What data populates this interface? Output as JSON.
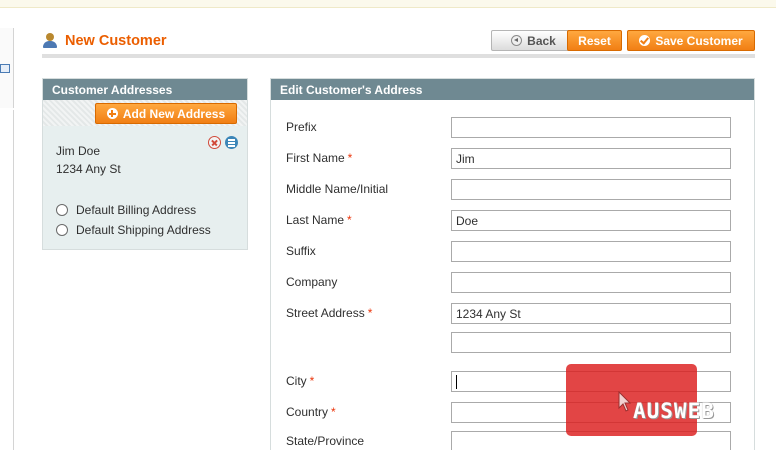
{
  "page": {
    "title": "New Customer",
    "buttons": {
      "back": "Back",
      "reset": "Reset",
      "save": "Save Customer"
    }
  },
  "addresses_panel": {
    "title": "Customer Addresses",
    "add_button": "Add New Address",
    "items": [
      {
        "name": "Jim Doe",
        "street": "1234 Any St"
      }
    ],
    "options": {
      "billing": "Default Billing Address",
      "shipping": "Default Shipping Address"
    }
  },
  "form": {
    "title": "Edit Customer's Address",
    "fields": {
      "prefix": {
        "label": "Prefix",
        "value": ""
      },
      "first_name": {
        "label": "First Name",
        "value": "Jim",
        "required": "*"
      },
      "middle_name": {
        "label": "Middle Name/Initial",
        "value": ""
      },
      "last_name": {
        "label": "Last Name",
        "value": "Doe",
        "required": "*"
      },
      "suffix": {
        "label": "Suffix",
        "value": ""
      },
      "company": {
        "label": "Company",
        "value": ""
      },
      "street": {
        "label": "Street Address",
        "value": "1234 Any St",
        "value2": "",
        "required": "*"
      },
      "city": {
        "label": "City",
        "value": "",
        "required": "*"
      },
      "country": {
        "label": "Country",
        "value": "",
        "required": "*"
      },
      "state": {
        "label": "State/Province",
        "value": ""
      }
    }
  },
  "watermark": {
    "text": "AUSWEB"
  },
  "colors": {
    "accent": "#eb5e00",
    "button_orange": "#f17f14",
    "panel_header": "#6f8992",
    "required": "#eb340a"
  }
}
